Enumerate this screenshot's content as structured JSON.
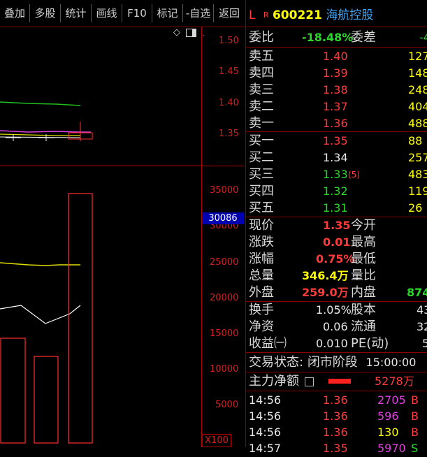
{
  "toolbar": {
    "items": [
      "叠加",
      "多股",
      "统计",
      "画线",
      "F10",
      "标记",
      "-自选",
      "返回"
    ]
  },
  "price_axis": {
    "ticks": [
      "1.50",
      "1.45",
      "1.40",
      "1.35"
    ]
  },
  "volume_axis": {
    "ticks": [
      "35000",
      "30000",
      "25000",
      "20000",
      "15000",
      "10000",
      "5000"
    ],
    "current_value": "30086",
    "multiplier": "X100"
  },
  "icons": {
    "diamond": "diamond-icon",
    "window": "window-icon",
    "menu": "menu-icon"
  },
  "quote": {
    "prefix_l": "L",
    "prefix_r": "R",
    "code": "600221",
    "name": "海航控股",
    "weibi_label": "委比",
    "weibi_value": "-18.48%",
    "weicha_label": "委差",
    "weicha_value": "-4"
  },
  "sells": [
    {
      "label": "卖五",
      "price": "1.40",
      "vol": "127"
    },
    {
      "label": "卖四",
      "price": "1.39",
      "vol": "148"
    },
    {
      "label": "卖三",
      "price": "1.38",
      "vol": "248"
    },
    {
      "label": "卖二",
      "price": "1.37",
      "vol": "404"
    },
    {
      "label": "卖一",
      "price": "1.36",
      "vol": "488"
    }
  ],
  "buys": [
    {
      "label": "买一",
      "price": "1.35",
      "vol": "88",
      "extra": ""
    },
    {
      "label": "买二",
      "price": "1.34",
      "vol": "257",
      "extra": ""
    },
    {
      "label": "买三",
      "price": "1.33",
      "vol": "483",
      "extra": "(5)"
    },
    {
      "label": "买四",
      "price": "1.32",
      "vol": "119",
      "extra": ""
    },
    {
      "label": "买五",
      "price": "1.31",
      "vol": "26",
      "extra": ""
    }
  ],
  "stats": {
    "xianjia_label": "现价",
    "xianjia": "1.35",
    "jinkai_label": "今开",
    "zhangdie_label": "涨跌",
    "zhangdie": "0.01",
    "zuigao_label": "最高",
    "zhangfu_label": "涨幅",
    "zhangfu": "0.75%",
    "zuidi_label": "最低",
    "zongliang_label": "总量",
    "zongliang": "346.4万",
    "liangbi_label": "量比",
    "waipan_label": "外盘",
    "waipan": "259.0万",
    "neipan_label": "内盘",
    "neipan": "874",
    "huanshou_label": "换手",
    "huanshou": "1.05%",
    "guben_label": "股本",
    "guben": "43",
    "jingzi_label": "净资",
    "jingzi": "0.06",
    "liutong_label": "流通",
    "liutong": "32",
    "shouyi_label": "收益㈠",
    "shouyi": "0.010",
    "pe_label": "PE(动)",
    "pe": "5"
  },
  "trade_status": {
    "label": "交易状态:",
    "value": "闭市阶段",
    "time": "15:00:00"
  },
  "main_flow": {
    "label": "主力净额",
    "value": "5278万"
  },
  "ticks": [
    {
      "time": "14:56",
      "price": "1.36",
      "vol": "2705",
      "side": "B"
    },
    {
      "time": "14:56",
      "price": "1.36",
      "vol": "596",
      "side": "B"
    },
    {
      "time": "14:56",
      "price": "1.36",
      "vol": "130",
      "side": "B"
    },
    {
      "time": "14:57",
      "price": "1.35",
      "vol": "5970",
      "side": "S"
    }
  ]
}
